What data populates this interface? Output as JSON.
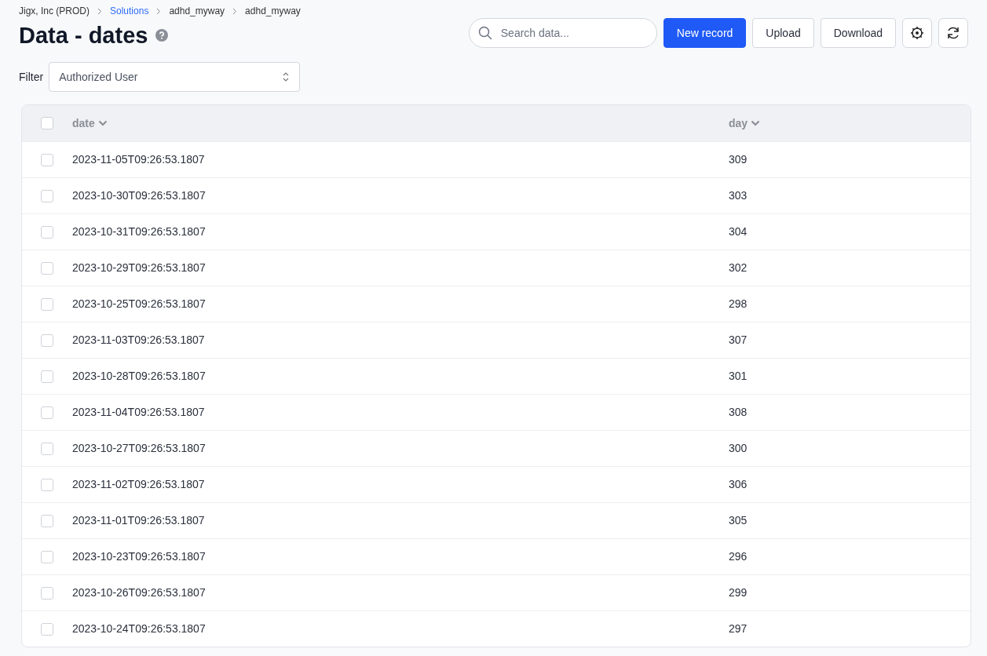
{
  "breadcrumbs": [
    {
      "label": "Jigx, Inc (PROD)",
      "kind": "text"
    },
    {
      "label": "Solutions",
      "kind": "link"
    },
    {
      "label": "adhd_myway",
      "kind": "text"
    },
    {
      "label": "adhd_myway",
      "kind": "text"
    }
  ],
  "title": "Data - dates",
  "search": {
    "placeholder": "Search data..."
  },
  "buttons": [
    {
      "label": "New record",
      "kind": "primary"
    },
    {
      "label": "Upload",
      "kind": "secondary"
    },
    {
      "label": "Download",
      "kind": "secondary"
    }
  ],
  "filter": {
    "label": "Filter",
    "value": "Authorized User"
  },
  "table": {
    "select_all_checked": false,
    "columns": [
      "date",
      "day"
    ],
    "rows": [
      {
        "checked": false,
        "cells": [
          "2023-11-05T09:26:53.1807",
          "309"
        ]
      },
      {
        "checked": false,
        "cells": [
          "2023-10-30T09:26:53.1807",
          "303"
        ]
      },
      {
        "checked": false,
        "cells": [
          "2023-10-31T09:26:53.1807",
          "304"
        ]
      },
      {
        "checked": false,
        "cells": [
          "2023-10-29T09:26:53.1807",
          "302"
        ]
      },
      {
        "checked": false,
        "cells": [
          "2023-10-25T09:26:53.1807",
          "298"
        ]
      },
      {
        "checked": false,
        "cells": [
          "2023-11-03T09:26:53.1807",
          "307"
        ]
      },
      {
        "checked": false,
        "cells": [
          "2023-10-28T09:26:53.1807",
          "301"
        ]
      },
      {
        "checked": false,
        "cells": [
          "2023-11-04T09:26:53.1807",
          "308"
        ]
      },
      {
        "checked": false,
        "cells": [
          "2023-10-27T09:26:53.1807",
          "300"
        ]
      },
      {
        "checked": false,
        "cells": [
          "2023-11-02T09:26:53.1807",
          "306"
        ]
      },
      {
        "checked": false,
        "cells": [
          "2023-11-01T09:26:53.1807",
          "305"
        ]
      },
      {
        "checked": false,
        "cells": [
          "2023-10-23T09:26:53.1807",
          "296"
        ]
      },
      {
        "checked": false,
        "cells": [
          "2023-10-26T09:26:53.1807",
          "299"
        ]
      },
      {
        "checked": false,
        "cells": [
          "2023-10-24T09:26:53.1807",
          "297"
        ]
      }
    ]
  }
}
